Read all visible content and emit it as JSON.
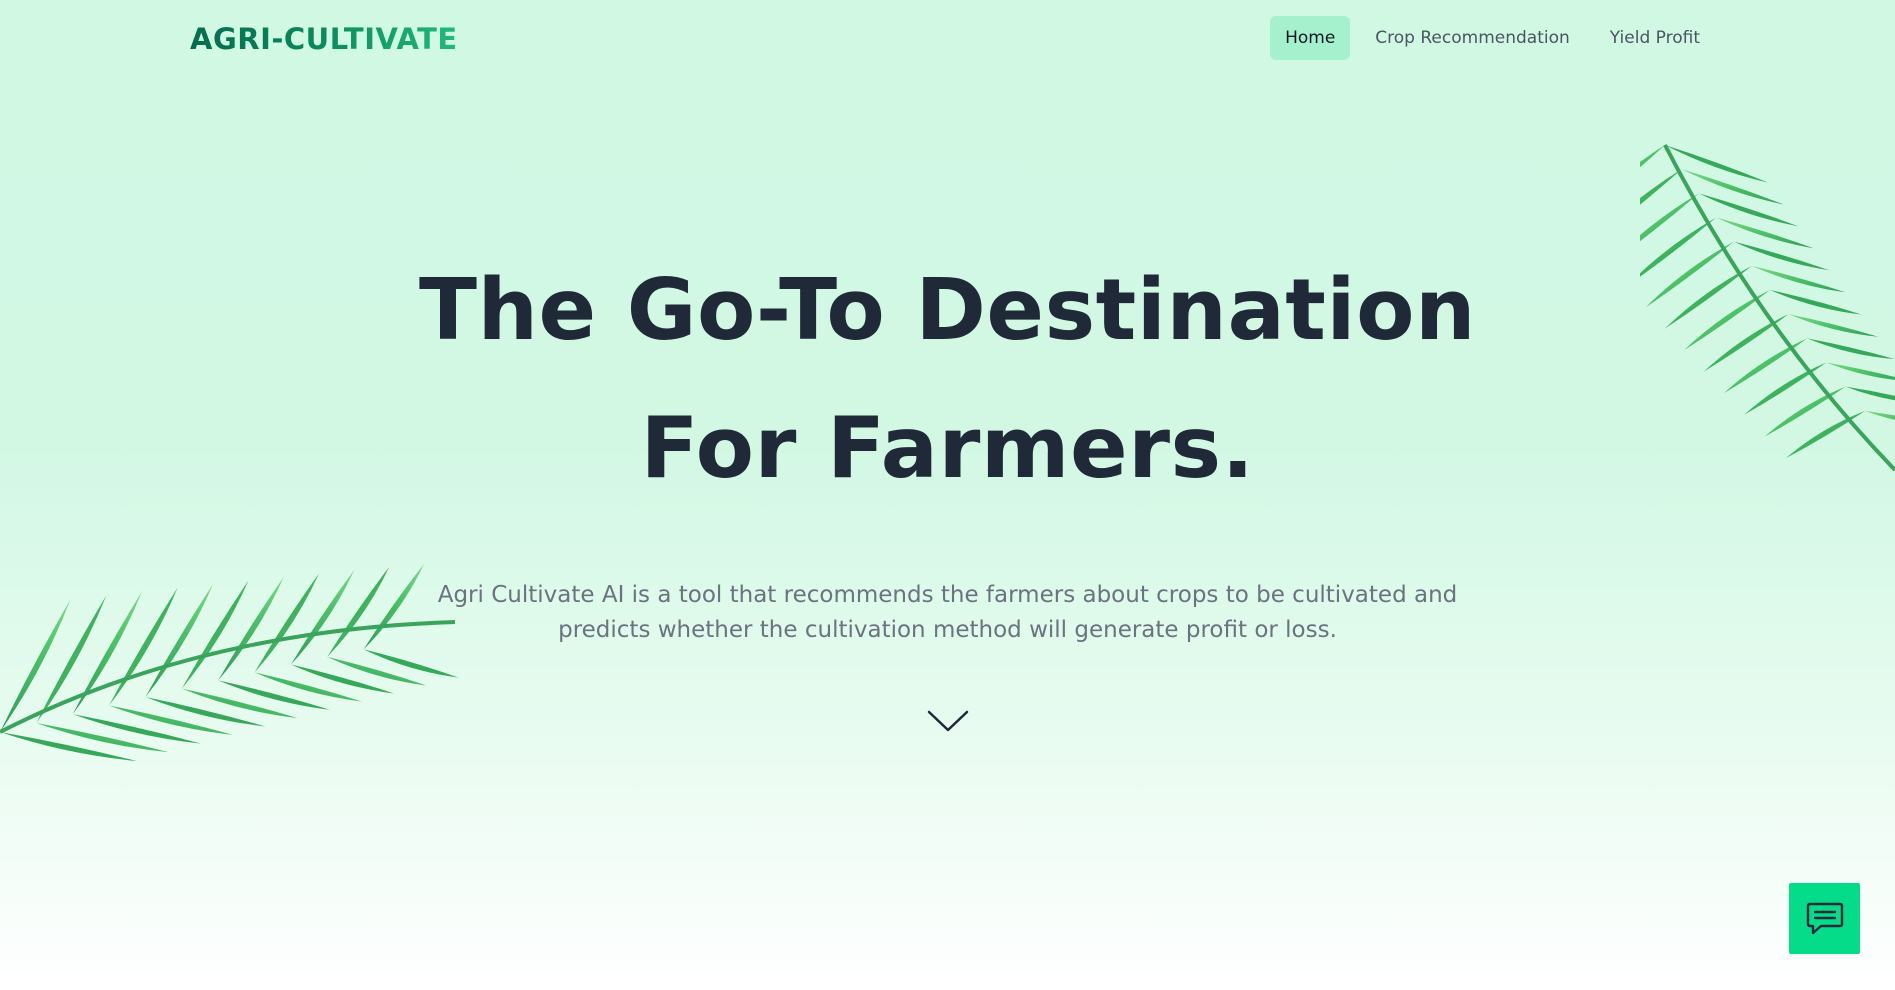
{
  "brand": {
    "logo_text": "AGRI-CULTIVATE",
    "gradient_colors": [
      "#046c4e",
      "#22b97c"
    ]
  },
  "nav": {
    "links": [
      {
        "label": "Home",
        "active": true
      },
      {
        "label": "Crop Recommendation",
        "active": false
      },
      {
        "label": "Yield Profit",
        "active": false
      }
    ]
  },
  "hero": {
    "title_line1": "The Go-To Destination",
    "title_line2": "For Farmers.",
    "description": "Agri Cultivate AI is a tool that recommends the farmers about crops to be cultivated and predicts whether the cultivation method will generate profit or loss.",
    "scroll_icon": "chevron-down-icon"
  },
  "chat": {
    "icon": "chat-icon"
  },
  "colors": {
    "accent": "#05dc8a",
    "active_nav_bg": "#a5f1cd",
    "title": "#1f2937",
    "body_text": "#6b7280",
    "leaf": "#4cc069"
  }
}
